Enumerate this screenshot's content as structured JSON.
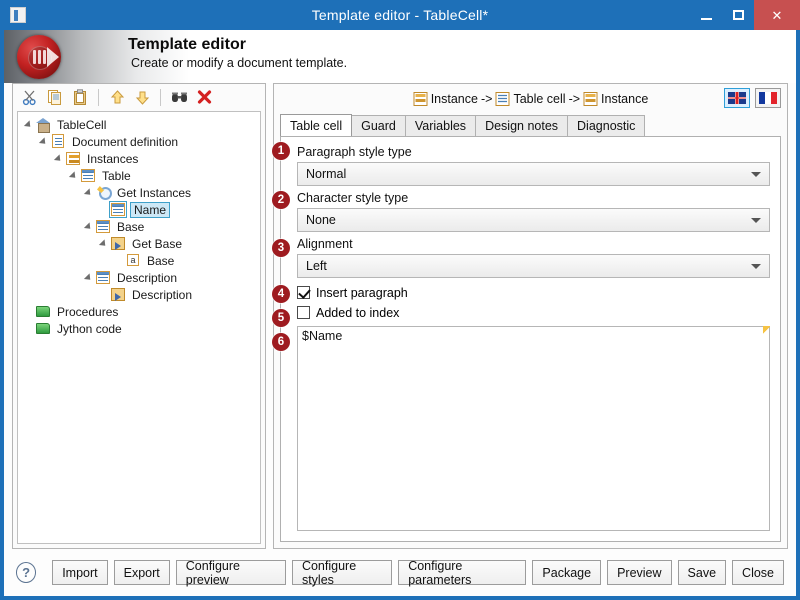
{
  "window": {
    "title": "Template editor - TableCell*",
    "app_icon": "document-icon",
    "minimize_label": "–",
    "maximize_label": "□",
    "close_label": "✕"
  },
  "banner": {
    "title": "Template editor",
    "subtitle": "Create or modify a document template.",
    "logo_name": "application-logo"
  },
  "tree_toolbar": {
    "buttons": [
      {
        "name": "cut-icon",
        "glyph": "✂",
        "title": "Cut"
      },
      {
        "name": "copy-icon",
        "glyph": "❐",
        "title": "Copy"
      },
      {
        "name": "paste-icon",
        "glyph": "Ὄb",
        "title": "Paste"
      },
      {
        "name": "move-up-icon",
        "glyph": "⇧",
        "title": "Move up"
      },
      {
        "name": "move-down-icon",
        "glyph": "⇩",
        "title": "Move down"
      },
      {
        "name": "search-icon",
        "glyph": "⌕",
        "title": "Find"
      },
      {
        "name": "delete-icon",
        "glyph": "✖",
        "title": "Delete"
      }
    ]
  },
  "tree": {
    "nodes": [
      {
        "label": "TableCell",
        "indent": 0,
        "icon": "house-icon",
        "expanded": true,
        "selected": false
      },
      {
        "label": "Document definition",
        "indent": 1,
        "icon": "document-icon",
        "expanded": true,
        "selected": false
      },
      {
        "label": "Instances",
        "indent": 2,
        "icon": "instances-icon",
        "expanded": true,
        "selected": false
      },
      {
        "label": "Table",
        "indent": 3,
        "icon": "table-icon",
        "expanded": true,
        "selected": false
      },
      {
        "label": "Get Instances",
        "indent": 4,
        "icon": "magnifier-icon",
        "expanded": true,
        "selected": false
      },
      {
        "label": "Name",
        "indent": 5,
        "icon": "table-icon",
        "expanded": false,
        "selected": true
      },
      {
        "label": "Base",
        "indent": 4,
        "icon": "table-icon",
        "expanded": true,
        "selected": false
      },
      {
        "label": "Get Base",
        "indent": 5,
        "icon": "getbase-icon",
        "expanded": true,
        "selected": false
      },
      {
        "label": "Base",
        "indent": 6,
        "icon": "attribute-icon",
        "expanded": false,
        "selected": false
      },
      {
        "label": "Description",
        "indent": 4,
        "icon": "table-icon",
        "expanded": true,
        "selected": false
      },
      {
        "label": "Description",
        "indent": 5,
        "icon": "arrow-box-icon",
        "expanded": false,
        "selected": false
      },
      {
        "label": "Procedures",
        "indent": 0,
        "icon": "folder-icon",
        "expanded": false,
        "selected": false
      },
      {
        "label": "Jython code",
        "indent": 0,
        "icon": "folder-icon",
        "expanded": false,
        "selected": false
      }
    ]
  },
  "breadcrumb": {
    "parts": [
      {
        "label": "Instance",
        "icon": "instance-icon"
      },
      {
        "label": "Table cell",
        "icon": "table-cell-icon"
      },
      {
        "label": "Instance",
        "icon": "instance-icon"
      }
    ],
    "separator": "->"
  },
  "languages": [
    {
      "name": "flag-uk",
      "label": "English",
      "active": true
    },
    {
      "name": "flag-fr",
      "label": "French",
      "active": false
    }
  ],
  "tabs": [
    {
      "label": "Table cell",
      "active": true
    },
    {
      "label": "Guard",
      "active": false
    },
    {
      "label": "Variables",
      "active": false
    },
    {
      "label": "Design notes",
      "active": false
    },
    {
      "label": "Diagnostic",
      "active": false
    }
  ],
  "form": {
    "paragraph_style": {
      "badge": "1",
      "label": "Paragraph style type",
      "value": "Normal"
    },
    "character_style": {
      "badge": "2",
      "label": "Character style type",
      "value": "None"
    },
    "alignment": {
      "badge": "3",
      "label": "Alignment",
      "value": "Left"
    },
    "insert_paragraph": {
      "badge": "4",
      "label": "Insert paragraph",
      "checked": true
    },
    "added_to_index": {
      "badge": "5",
      "label": "Added to index",
      "checked": false
    },
    "content": {
      "badge": "6",
      "value": "$Name"
    }
  },
  "footer": {
    "help_glyph": "?",
    "buttons": [
      "Import",
      "Export",
      "Configure preview",
      "Configure styles",
      "Configure parameters",
      "Package",
      "Preview",
      "Save",
      "Close"
    ]
  },
  "colors": {
    "titlebar": "#1e70b8",
    "close_button": "#c75050",
    "badge": "#9e1b20",
    "selection": "#cde8f6",
    "accent_border": "#3fa0c9"
  }
}
